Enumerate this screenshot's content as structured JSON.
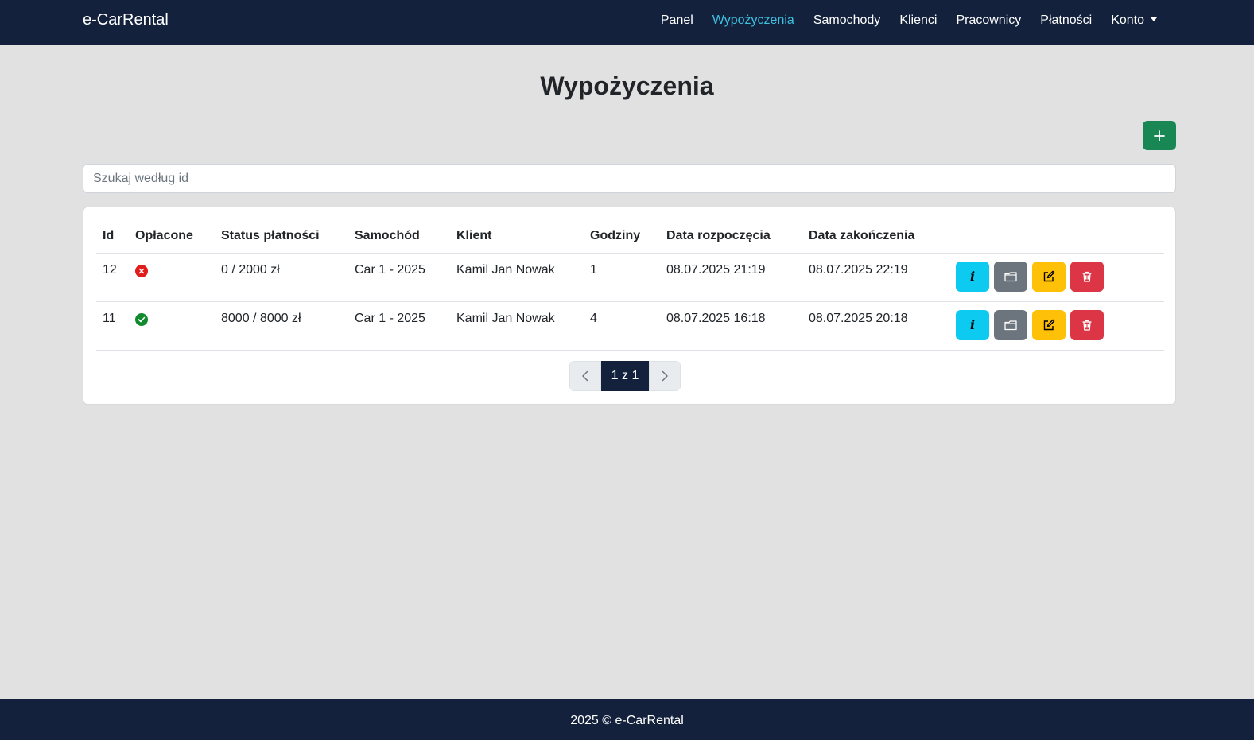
{
  "navbar": {
    "brand": "e-CarRental",
    "items": [
      {
        "label": "Panel",
        "active": false
      },
      {
        "label": "Wypożyczenia",
        "active": true
      },
      {
        "label": "Samochody",
        "active": false
      },
      {
        "label": "Klienci",
        "active": false
      },
      {
        "label": "Pracownicy",
        "active": false
      },
      {
        "label": "Płatności",
        "active": false
      }
    ],
    "account_label": "Konto"
  },
  "page": {
    "title": "Wypożyczenia",
    "add_icon": "plus-icon"
  },
  "search": {
    "placeholder": "Szukaj według id",
    "value": ""
  },
  "table": {
    "headers": [
      "Id",
      "Opłacone",
      "Status płatności",
      "Samochód",
      "Klient",
      "Godziny",
      "Data rozpoczęcia",
      "Data zakończenia"
    ],
    "rows": [
      {
        "id": "12",
        "paid": false,
        "payment_status": "0 / 2000 zł",
        "car": "Car 1 - 2025",
        "client": "Kamil Jan Nowak",
        "hours": "1",
        "start": "08.07.2025 21:19",
        "end": "08.07.2025 22:19"
      },
      {
        "id": "11",
        "paid": true,
        "payment_status": "8000 / 8000 zł",
        "car": "Car 1 - 2025",
        "client": "Kamil Jan Nowak",
        "hours": "4",
        "start": "08.07.2025 16:18",
        "end": "08.07.2025 20:18"
      }
    ],
    "actions": {
      "info_label": "i",
      "icons": [
        "info-icon",
        "folder-icon",
        "edit-icon",
        "trash-icon"
      ]
    }
  },
  "pagination": {
    "current": "1 z 1"
  },
  "footer": {
    "text": "2025 © e-CarRental"
  },
  "colors": {
    "navbar": "#13213c",
    "active_link": "#3fc0e0",
    "success": "#198754",
    "info": "#0dcaf0",
    "secondary": "#6c757d",
    "warning": "#ffc107",
    "danger": "#dc3545"
  }
}
